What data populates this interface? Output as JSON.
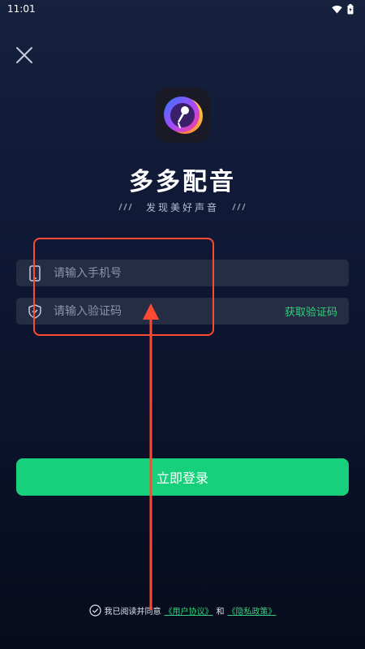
{
  "status": {
    "time": "11:01"
  },
  "app": {
    "name": "多多配音",
    "tagline": "发现美好声音"
  },
  "form": {
    "phone_placeholder": "请输入手机号",
    "code_placeholder": "请输入验证码",
    "get_code_label": "获取验证码"
  },
  "login_button": "立即登录",
  "agreement": {
    "prefix": "我已阅读并同意",
    "user_agreement": "《用户协议》",
    "and": "和",
    "privacy_policy": "《隐私政策》"
  },
  "colors": {
    "accent": "#16d07c",
    "annotation": "#ff4a32"
  },
  "icons": [
    "wifi-icon",
    "battery-icon",
    "close-icon",
    "microphone-logo-icon",
    "phone-icon",
    "shield-icon",
    "check-circle-icon"
  ]
}
